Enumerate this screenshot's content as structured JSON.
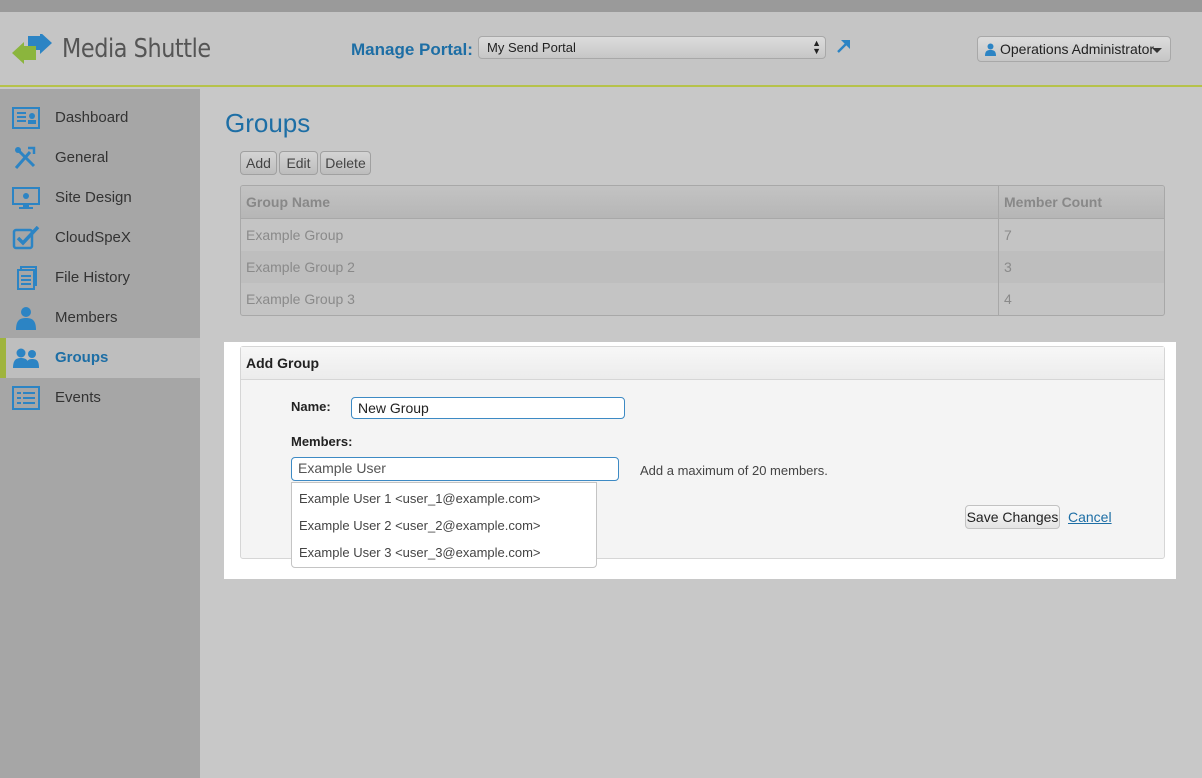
{
  "header": {
    "app_name": "Media Shuttle",
    "manage_label": "Manage Portal:",
    "portal_value": "My Send Portal",
    "user_label": "Operations Administrator"
  },
  "sidebar": {
    "items": [
      {
        "label": "Dashboard",
        "icon": "dashboard-icon"
      },
      {
        "label": "General",
        "icon": "tools-icon"
      },
      {
        "label": "Site Design",
        "icon": "site-design-icon"
      },
      {
        "label": "CloudSpeX",
        "icon": "checkbox-icon"
      },
      {
        "label": "File History",
        "icon": "file-history-icon"
      },
      {
        "label": "Members",
        "icon": "member-icon"
      },
      {
        "label": "Groups",
        "icon": "groups-icon",
        "active": true
      },
      {
        "label": "Events",
        "icon": "events-icon"
      }
    ]
  },
  "main": {
    "title": "Groups",
    "toolbar": {
      "add": "Add",
      "edit": "Edit",
      "delete": "Delete"
    },
    "table": {
      "columns": [
        "Group Name",
        "Member Count"
      ],
      "rows": [
        [
          "Example Group",
          "7"
        ],
        [
          "Example Group 2",
          "3"
        ],
        [
          "Example Group 3",
          "4"
        ]
      ]
    }
  },
  "dialog": {
    "title": "Add Group",
    "name_label": "Name:",
    "name_value": "New Group",
    "members_label": "Members:",
    "members_value": "Example User",
    "hint": "Add a maximum of 20 members.",
    "save": "Save Changes",
    "cancel": "Cancel",
    "suggestions": [
      "Example User 1 <user_1@example.com>",
      "Example User 2 <user_2@example.com>",
      "Example User 3 <user_3@example.com>"
    ]
  },
  "colors": {
    "accent_blue": "#1d6ea5",
    "active_bar_green": "#9fb43d",
    "logo_green": "#8bb53d",
    "logo_blue": "#2c84c4"
  }
}
